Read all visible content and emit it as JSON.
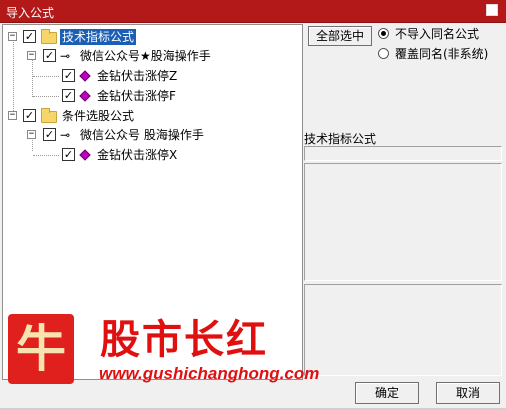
{
  "window": {
    "title": "导入公式"
  },
  "tree": {
    "nodes": [
      {
        "label": "技术指标公式",
        "checked": true,
        "expanded": true,
        "selected": true,
        "icon": "folder-icon"
      },
      {
        "label": "微信公众号★股海操作手",
        "checked": true,
        "expanded": true,
        "icon": "key-icon"
      },
      {
        "label": "金钻伏击涨停Z",
        "checked": true,
        "icon": "diamond-icon"
      },
      {
        "label": "金钻伏击涨停F",
        "checked": true,
        "icon": "diamond-icon"
      },
      {
        "label": "条件选股公式",
        "checked": true,
        "expanded": true,
        "icon": "folder-icon"
      },
      {
        "label": "微信公众号 股海操作手",
        "checked": true,
        "expanded": true,
        "icon": "key-icon"
      },
      {
        "label": "金钻伏击涨停X",
        "checked": true,
        "icon": "diamond-icon"
      }
    ],
    "check_mark": "✓",
    "expander_minus": "−"
  },
  "actions": {
    "select_all_label": "全部选中",
    "ok_label": "确定",
    "cancel_label": "取消"
  },
  "options": {
    "radio_no_import_same": "不导入同名公式",
    "radio_overwrite_same": "覆盖同名(非系统)",
    "selected": "no_import_same"
  },
  "info": {
    "section_label": "技术指标公式"
  },
  "watermark": {
    "seal_char": "牛",
    "title": "股市长红",
    "url": "www.gushichanghong.com"
  },
  "colors": {
    "title_bar": "#b31919",
    "selection": "#1a5fb4",
    "watermark_red": "#e01010",
    "diamond": "#c000c0"
  }
}
